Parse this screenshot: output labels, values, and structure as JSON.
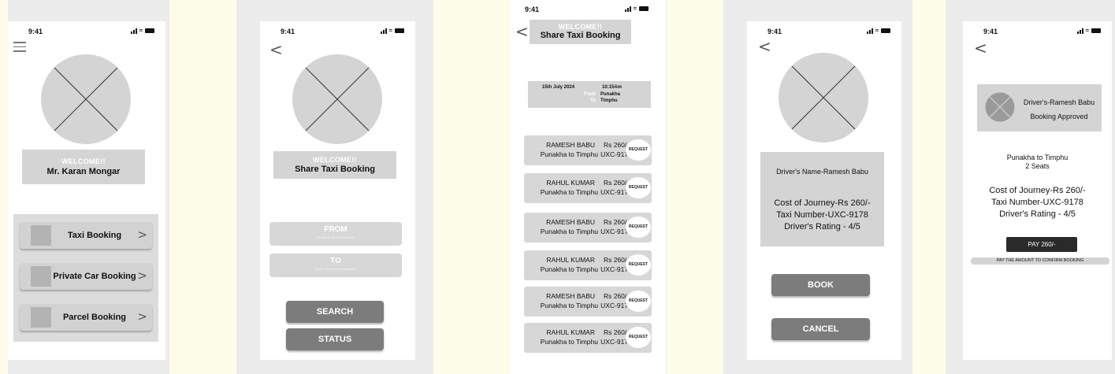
{
  "status_time": "9:41",
  "colors": {
    "placeholder_gray": "#d4d4d4",
    "dark_button": "#7c7c7c",
    "pay_button": "#2a2a2a"
  },
  "screen1": {
    "welcome": "WELCOME!!",
    "user_name": "Mr. Karan Mongar",
    "menu": [
      {
        "label": "Taxi Booking",
        "icon": "chevron-right-icon"
      },
      {
        "label": "Private Car Booking",
        "icon": "chevron-right-icon"
      },
      {
        "label": "Parcel Booking",
        "icon": "chevron-right-icon"
      }
    ]
  },
  "screen2": {
    "welcome": "WELCOME!!",
    "title": "Share Taxi Booking",
    "from_label": "FROM",
    "from_placeholder": "Please Enter Your location",
    "to_label": "TO",
    "to_placeholder": "Please Enter Your Destination",
    "search_label": "SEARCH",
    "status_label": "STATUS"
  },
  "screen3": {
    "welcome": "WELCOME!!",
    "title": "Share Taxi Booking",
    "date": "15th July 2024",
    "time": "10:15Am",
    "from_key": "From",
    "from_value": "Punakha",
    "to_key": "To",
    "to_value": "Timphu",
    "request_label": "REQUEST",
    "rides": [
      {
        "driver": "RAMESH BABU",
        "route": "Punakha to Timphu",
        "price": "Rs 260/-",
        "taxi": "UXC-9178"
      },
      {
        "driver": "RAHUL KUMAR",
        "route": "Punakha to Timphu",
        "price": "Rs 260/-",
        "taxi": "UXC-9178"
      },
      {
        "driver": "RAMESH BABU",
        "route": "Punakha to Timphu",
        "price": "Rs 260/-",
        "taxi": "UXC-9178"
      },
      {
        "driver": "RAHUL KUMAR",
        "route": "Punakha to Timphu",
        "price": "Rs 260/-",
        "taxi": "UXC-9178"
      },
      {
        "driver": "RAMESH BABU",
        "route": "Punakha to Timphu",
        "price": "Rs 260/-",
        "taxi": "UXC-9178"
      },
      {
        "driver": "RAHUL KUMAR",
        "route": "Punakha to Timphu",
        "price": "Rs 260/-",
        "taxi": "UXC-9178"
      }
    ]
  },
  "screen4": {
    "driver_name": "Driver's Name-Ramesh Babu",
    "cost": "Cost of Journey-Rs 260/-",
    "taxi_number": "Taxi Number-UXC-9178",
    "rating": "Driver's Rating - 4/5",
    "book_label": "BOOK",
    "cancel_label": "CANCEL"
  },
  "screen5": {
    "driver": "Driver's-Ramesh Babu",
    "approved": "Booking Approved",
    "route": "Punakha to Timphu",
    "seats": "2 Seats",
    "cost": "Cost of Journey-Rs 260/-",
    "taxi_number": "Taxi Number-UXC-9178",
    "rating": "Driver's Rating - 4/5",
    "pay_label": "PAY 260/-",
    "pay_note": "PAY THE AMOUNT TO CONFIRM BOOKING"
  }
}
